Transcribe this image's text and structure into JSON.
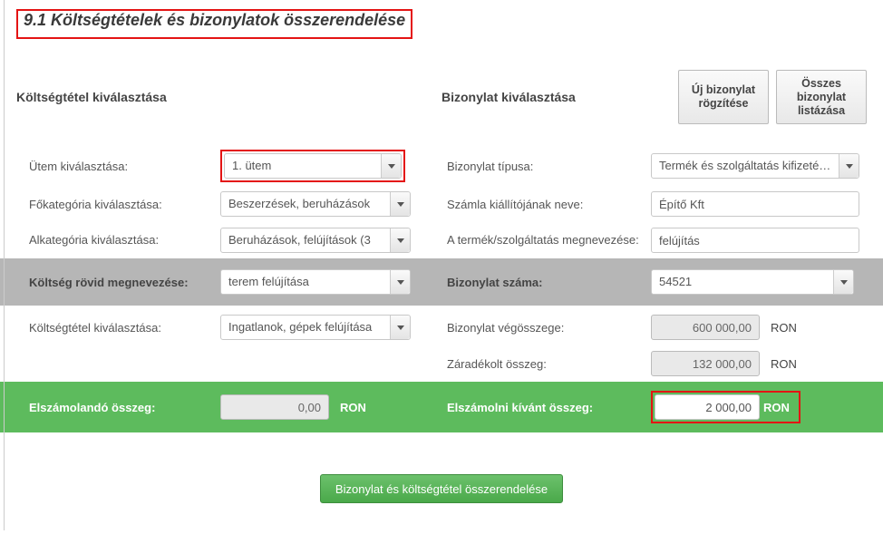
{
  "section_title": "9.1 Költségtételek és bizonylatok összerendelése",
  "left_header": "Költségtétel kiválasztása",
  "right_header": "Bizonylat kiválasztása",
  "buttons": {
    "new_voucher": "Új bizonylat rögzítése",
    "list_vouchers": "Összes bizonylat listázása",
    "pair": "Bizonylat és költségtétel összerendelése"
  },
  "left": {
    "utem_label": "Ütem kiválasztása:",
    "utem_value": "1. ütem",
    "fokat_label": "Főkategória kiválasztása:",
    "fokat_value": "Beszerzések, beruházások",
    "alkat_label": "Alkategória kiválasztása:",
    "alkat_value": "Beruházások, felújítások (3",
    "rovid_label": "Költség rövid megnevezése:",
    "rovid_value": "terem felújítása",
    "tetel_label": "Költségtétel kiválasztása:",
    "tetel_value": "Ingatlanok, gépek felújítása",
    "elszam_label": "Elszámolandó összeg:",
    "elszam_value": "0,00",
    "elszam_curr": "RON"
  },
  "right": {
    "tipus_label": "Bizonylat típusa:",
    "tipus_value": "Termék és szolgáltatás kifizetése",
    "kiallito_label": "Számla kiállítójának neve:",
    "kiallito_value": "Építő Kft",
    "termek_label": "A termék/szolgáltatás megnevezése:",
    "termek_value": "felújítás",
    "szam_label": "Bizonylat száma:",
    "szam_value": "54521",
    "vegosszeg_label": "Bizonylat végösszege:",
    "vegosszeg_value": "600 000,00",
    "vegosszeg_curr": "RON",
    "zaradek_label": "Záradékolt összeg:",
    "zaradek_value": "132 000,00",
    "zaradek_curr": "RON",
    "kivant_label": "Elszámolni kívánt összeg:",
    "kivant_value": "2 000,00",
    "kivant_curr": "RON"
  }
}
